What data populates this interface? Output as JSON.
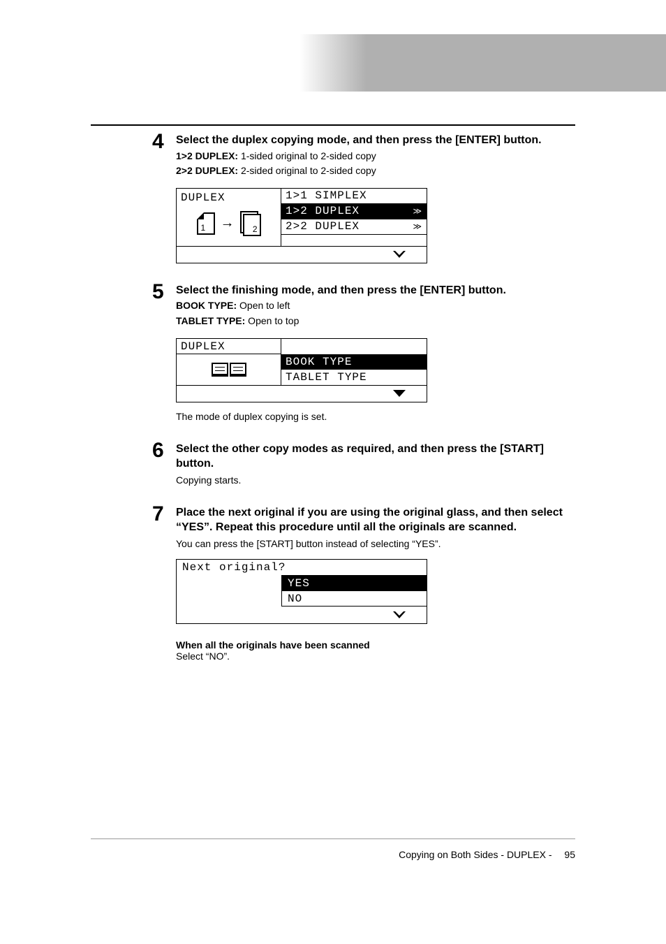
{
  "steps": {
    "s4": {
      "num": "4",
      "title": "Select the duplex copying mode, and then press the [ENTER] button.",
      "line1_label": "1>2 DUPLEX:",
      "line1_text": " 1-sided original to 2-sided copy",
      "line2_label": "2>2 DUPLEX:",
      "line2_text": " 2-sided original to 2-sided copy"
    },
    "s5": {
      "num": "5",
      "title": "Select the finishing mode, and then press the [ENTER] button.",
      "line1_label": "BOOK TYPE:",
      "line1_text": " Open to left",
      "line2_label": "TABLET TYPE:",
      "line2_text": " Open to top",
      "after": "The mode of duplex copying is set."
    },
    "s6": {
      "num": "6",
      "title": "Select the other copy modes as required, and then press the [START] button.",
      "after": "Copying starts."
    },
    "s7": {
      "num": "7",
      "title": "Place the next original if you are using the original glass, and then select “YES”. Repeat this procedure until all the originals are scanned.",
      "after": "You can press the [START] button instead of selecting “YES”.",
      "sub_bold": "When all the originals have been scanned",
      "sub_text": "Select “NO”."
    }
  },
  "lcd1": {
    "title": "DUPLEX",
    "items": [
      "1>1 SIMPLEX",
      "1>2 DUPLEX",
      "2>2 DUPLEX"
    ],
    "selected_index": 1
  },
  "lcd2": {
    "title": "DUPLEX",
    "items": [
      "BOOK TYPE",
      "TABLET TYPE"
    ],
    "selected_index": 0
  },
  "lcd3": {
    "title": "Next original?",
    "items": [
      "YES",
      "NO"
    ],
    "selected_index": 0
  },
  "footer": {
    "text": "Copying on Both Sides - DUPLEX -",
    "page": "95"
  }
}
